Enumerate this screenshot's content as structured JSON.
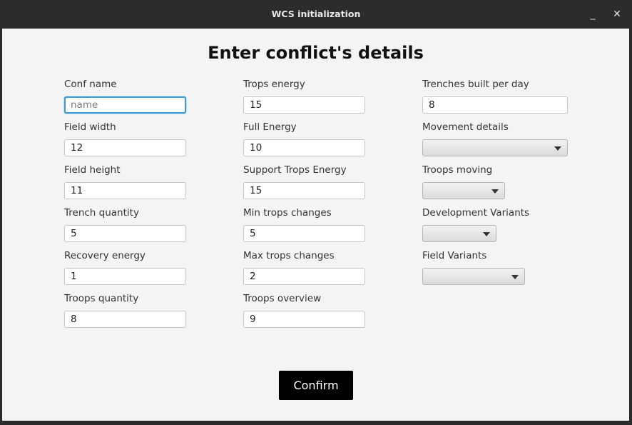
{
  "window": {
    "title": "WCS initialization",
    "minimize": "_",
    "close": "✕"
  },
  "heading": "Enter conflict's details",
  "col1": [
    {
      "label": "Conf name",
      "value": "",
      "placeholder": "name"
    },
    {
      "label": "Field width",
      "value": "12"
    },
    {
      "label": "Field height",
      "value": "11"
    },
    {
      "label": "Trench quantity",
      "value": "5"
    },
    {
      "label": "Recovery energy",
      "value": "1"
    },
    {
      "label": "Troops quantity",
      "value": "8"
    }
  ],
  "col2": [
    {
      "label": "Trops energy",
      "value": "15"
    },
    {
      "label": "Full Energy",
      "value": "10"
    },
    {
      "label": "Support Trops Energy",
      "value": "15"
    },
    {
      "label": "Min trops changes",
      "value": "5"
    },
    {
      "label": "Max trops changes",
      "value": "2"
    },
    {
      "label": "Troops overview",
      "value": "9"
    }
  ],
  "col3": [
    {
      "label": "Trenches built per day",
      "value": "8"
    },
    {
      "label": "Movement details",
      "selected": ""
    },
    {
      "label": "Troops moving",
      "selected": ""
    },
    {
      "label": "Development Variants",
      "selected": ""
    },
    {
      "label": "Field Variants",
      "selected": ""
    }
  ],
  "confirm_label": "Confirm"
}
